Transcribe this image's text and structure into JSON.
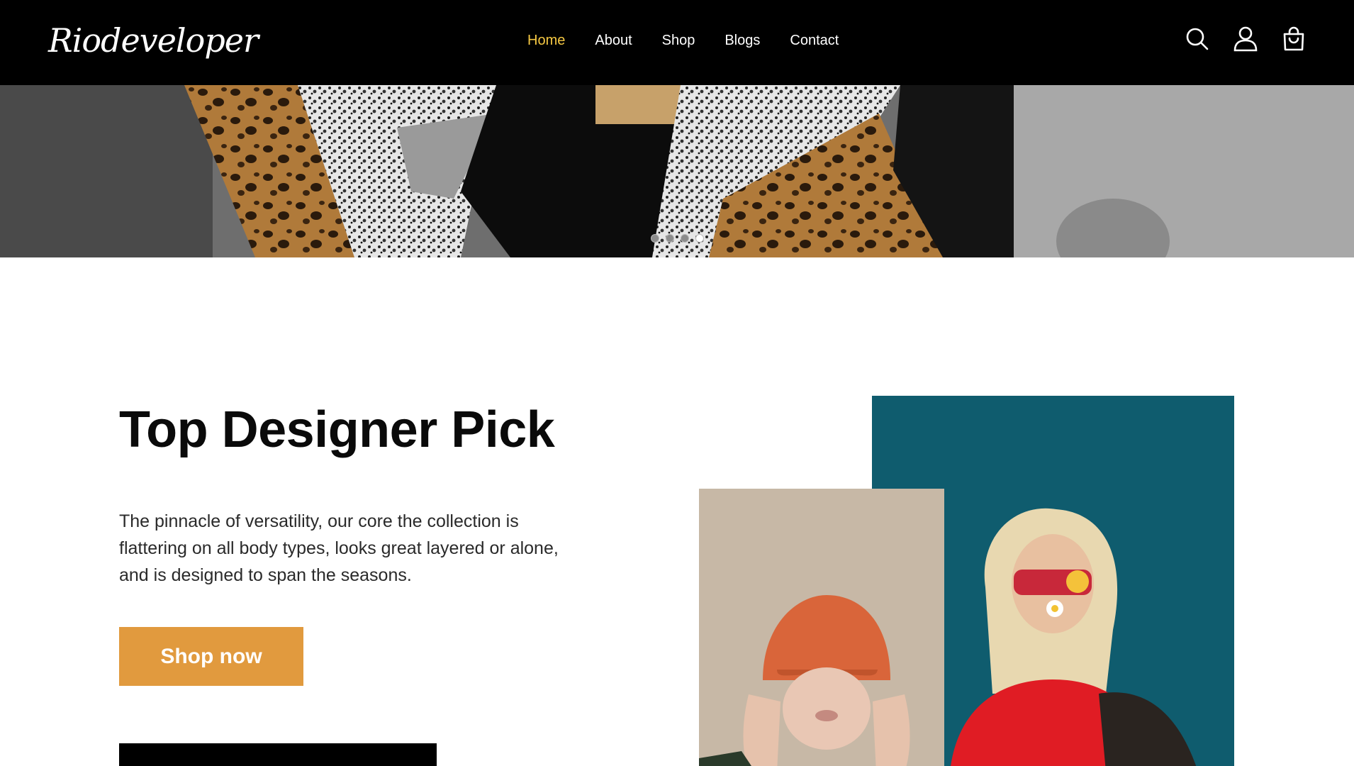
{
  "header": {
    "logo": "Riodeveloper",
    "nav": [
      {
        "label": "Home",
        "active": true
      },
      {
        "label": "About",
        "active": false
      },
      {
        "label": "Shop",
        "active": false
      },
      {
        "label": "Blogs",
        "active": false
      },
      {
        "label": "Contact",
        "active": false
      }
    ],
    "icons": [
      "search-icon",
      "user-icon",
      "shopping-bag-icon"
    ],
    "active_color": "#f5c843"
  },
  "hero": {
    "slide_count": 4,
    "active_slide": 4
  },
  "feature": {
    "title": "Top Designer Pick",
    "description": "The pinnacle of versatility, our core the collection is flattering on all body types, looks great layered or alone, and is designed to span the seasons.",
    "button_label": "Shop now",
    "button_color": "#e19a3e"
  }
}
